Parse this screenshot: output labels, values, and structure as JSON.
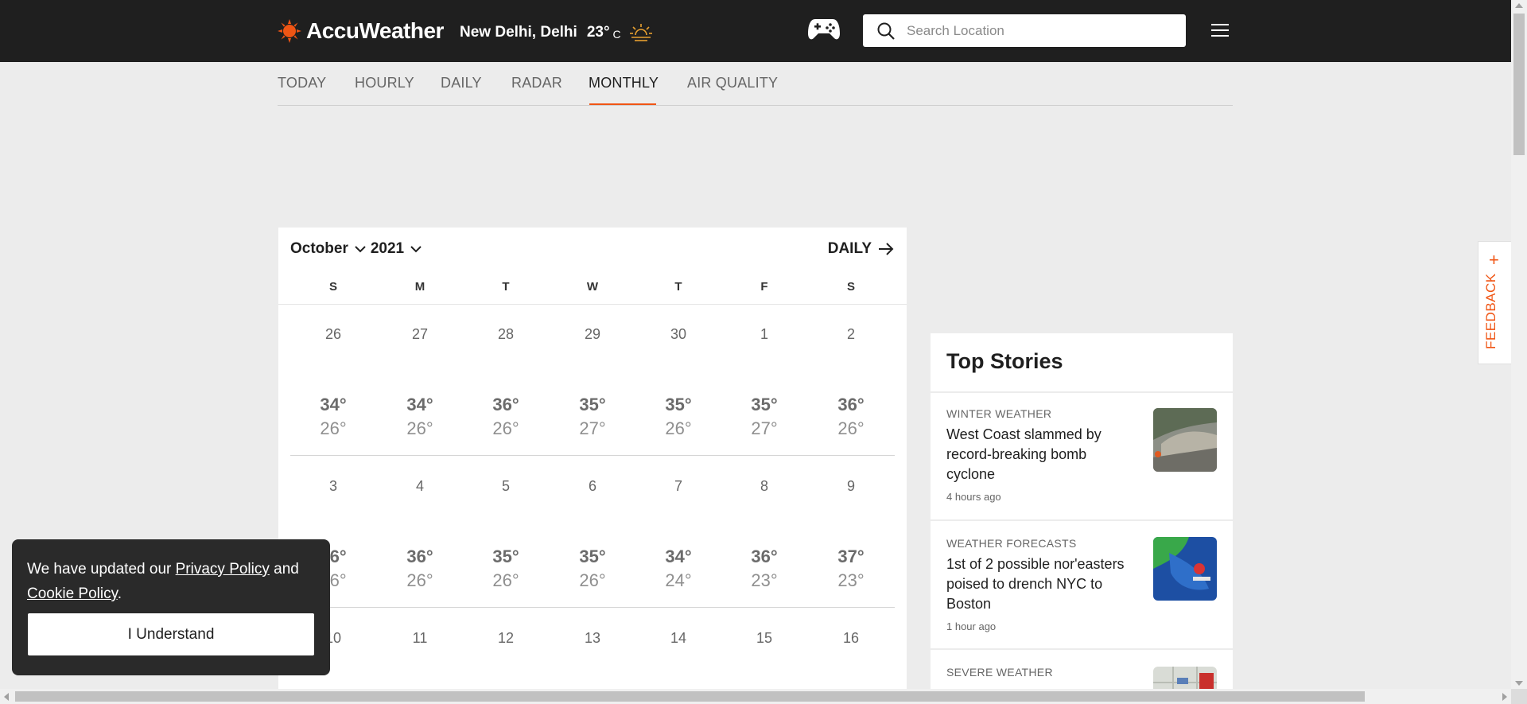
{
  "brand": {
    "name": "AccuWeather",
    "accent": "#f05514"
  },
  "header": {
    "location": "New Delhi, Delhi",
    "temperature": "23°",
    "unit": "C",
    "weather_icon": "sunset-icon",
    "search_placeholder": "Search Location"
  },
  "nav": {
    "tabs": [
      {
        "label": "TODAY"
      },
      {
        "label": "HOURLY"
      },
      {
        "label": "DAILY"
      },
      {
        "label": "RADAR"
      },
      {
        "label": "MONTHLY",
        "active": true
      },
      {
        "label": "AIR QUALITY"
      }
    ]
  },
  "calendar": {
    "month": "October",
    "year": "2021",
    "daily_link": "DAILY",
    "weekdays": [
      "S",
      "M",
      "T",
      "W",
      "T",
      "F",
      "S"
    ],
    "weeks": [
      [
        {
          "date": "26",
          "hi": "34°",
          "lo": "26°"
        },
        {
          "date": "27",
          "hi": "34°",
          "lo": "26°"
        },
        {
          "date": "28",
          "hi": "36°",
          "lo": "26°"
        },
        {
          "date": "29",
          "hi": "35°",
          "lo": "27°"
        },
        {
          "date": "30",
          "hi": "35°",
          "lo": "26°"
        },
        {
          "date": "1",
          "hi": "35°",
          "lo": "27°"
        },
        {
          "date": "2",
          "hi": "36°",
          "lo": "26°"
        }
      ],
      [
        {
          "date": "3",
          "hi": "36°",
          "lo": "26°"
        },
        {
          "date": "4",
          "hi": "36°",
          "lo": "26°"
        },
        {
          "date": "5",
          "hi": "35°",
          "lo": "26°"
        },
        {
          "date": "6",
          "hi": "35°",
          "lo": "26°"
        },
        {
          "date": "7",
          "hi": "34°",
          "lo": "24°"
        },
        {
          "date": "8",
          "hi": "36°",
          "lo": "23°"
        },
        {
          "date": "9",
          "hi": "37°",
          "lo": "23°"
        }
      ],
      [
        {
          "date": "10",
          "hi": "",
          "lo": ""
        },
        {
          "date": "11",
          "hi": "",
          "lo": ""
        },
        {
          "date": "12",
          "hi": "",
          "lo": ""
        },
        {
          "date": "13",
          "hi": "",
          "lo": ""
        },
        {
          "date": "14",
          "hi": "",
          "lo": ""
        },
        {
          "date": "15",
          "hi": "",
          "lo": ""
        },
        {
          "date": "16",
          "hi": "",
          "lo": ""
        }
      ]
    ]
  },
  "top_stories": {
    "heading": "Top Stories",
    "items": [
      {
        "category": "WINTER WEATHER",
        "title": "West Coast slammed by record-breaking bomb cyclone",
        "ago": "4 hours ago"
      },
      {
        "category": "WEATHER FORECASTS",
        "title": "1st of 2 possible nor'easters poised to drench NYC to Boston",
        "ago": "1 hour ago"
      },
      {
        "category": "SEVERE WEATHER",
        "title": "",
        "ago": ""
      }
    ]
  },
  "feedback": {
    "label": "FEEDBACK",
    "plus": "+"
  },
  "cookie": {
    "text_before": "We have updated our ",
    "privacy_link": "Privacy Policy",
    "text_mid": " and",
    "cookie_link": "Cookie Policy",
    "text_after": ".",
    "button": "I Understand"
  }
}
